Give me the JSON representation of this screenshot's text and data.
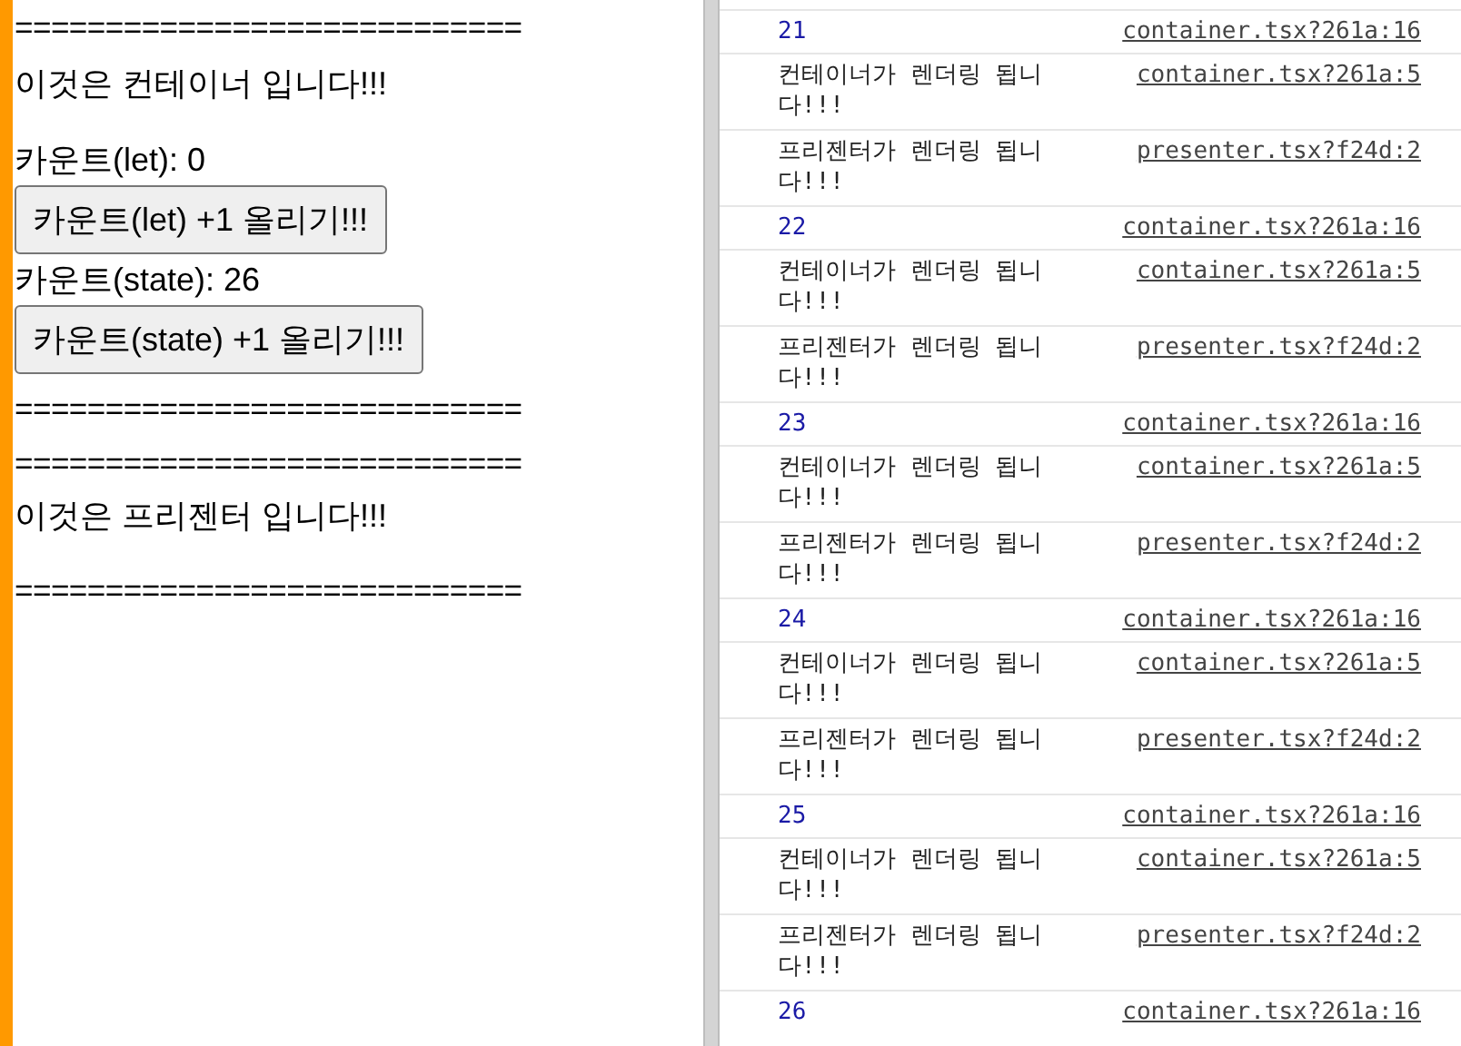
{
  "app": {
    "container": {
      "top_rule": "============================",
      "heading": "이것은 컨테이너 입니다!!!",
      "let_count": "카운트(let): 0",
      "let_button": "카운트(let) +1 올리기!!!",
      "state_count": "카운트(state): 26",
      "state_button": "카운트(state) +1 올리기!!!",
      "bottom_rule": "============================"
    },
    "presenter": {
      "top_rule": "============================",
      "heading": "이것은 프리젠터 입니다!!!",
      "bottom_rule": "============================"
    }
  },
  "console": {
    "rows": [
      {
        "kind": "value",
        "text": "21",
        "source": "container.tsx?261a:16"
      },
      {
        "kind": "message",
        "text": "컨테이너가 렌더링 됩니다!!!",
        "source": "container.tsx?261a:5"
      },
      {
        "kind": "message",
        "text": "프리젠터가 렌더링 됩니다!!!",
        "source": "presenter.tsx?f24d:2"
      },
      {
        "kind": "value",
        "text": "22",
        "source": "container.tsx?261a:16"
      },
      {
        "kind": "message",
        "text": "컨테이너가 렌더링 됩니다!!!",
        "source": "container.tsx?261a:5"
      },
      {
        "kind": "message",
        "text": "프리젠터가 렌더링 됩니다!!!",
        "source": "presenter.tsx?f24d:2"
      },
      {
        "kind": "value",
        "text": "23",
        "source": "container.tsx?261a:16"
      },
      {
        "kind": "message",
        "text": "컨테이너가 렌더링 됩니다!!!",
        "source": "container.tsx?261a:5"
      },
      {
        "kind": "message",
        "text": "프리젠터가 렌더링 됩니다!!!",
        "source": "presenter.tsx?f24d:2"
      },
      {
        "kind": "value",
        "text": "24",
        "source": "container.tsx?261a:16"
      },
      {
        "kind": "message",
        "text": "컨테이너가 렌더링 됩니다!!!",
        "source": "container.tsx?261a:5"
      },
      {
        "kind": "message",
        "text": "프리젠터가 렌더링 됩니다!!!",
        "source": "presenter.tsx?f24d:2"
      },
      {
        "kind": "value",
        "text": "25",
        "source": "container.tsx?261a:16"
      },
      {
        "kind": "message",
        "text": "컨테이너가 렌더링 됩니다!!!",
        "source": "container.tsx?261a:5"
      },
      {
        "kind": "message",
        "text": "프리젠터가 렌더링 됩니다!!!",
        "source": "presenter.tsx?f24d:2"
      },
      {
        "kind": "value",
        "text": "26",
        "source": "container.tsx?261a:16"
      }
    ]
  }
}
